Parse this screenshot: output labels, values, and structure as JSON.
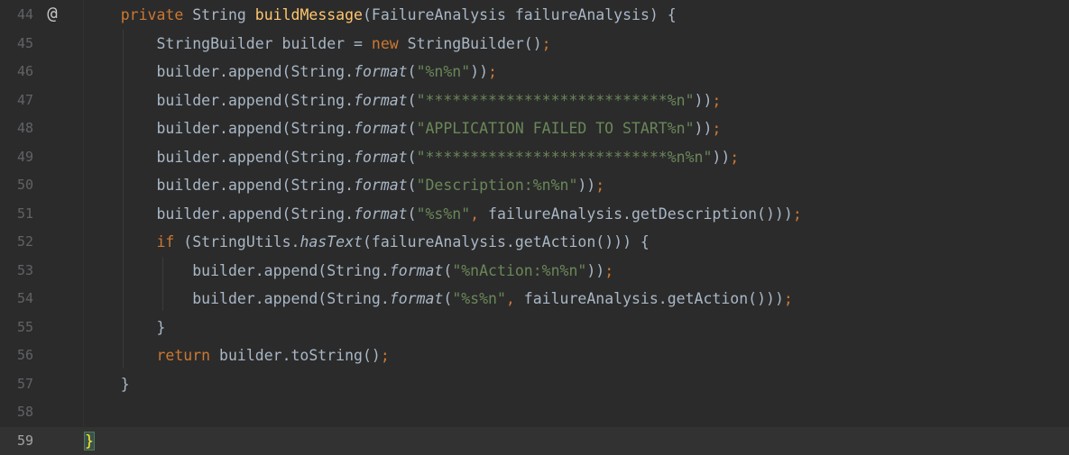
{
  "editor": {
    "language": "java",
    "current_line": 59,
    "gutter_icon": "at-sign-icon",
    "gutter_icon_glyph": "@",
    "lines": [
      {
        "num": "44",
        "segments": [
          {
            "t": "    ",
            "c": ""
          },
          {
            "t": "private ",
            "c": "kw"
          },
          {
            "t": "String ",
            "c": ""
          },
          {
            "t": "buildMessage",
            "c": "fn"
          },
          {
            "t": "(FailureAnalysis failureAnalysis) {",
            "c": ""
          }
        ]
      },
      {
        "num": "45",
        "segments": [
          {
            "t": "        StringBuilder builder = ",
            "c": ""
          },
          {
            "t": "new ",
            "c": "kw"
          },
          {
            "t": "StringBuilder()",
            "c": ""
          },
          {
            "t": ";",
            "c": "punct"
          }
        ]
      },
      {
        "num": "46",
        "segments": [
          {
            "t": "        builder.append(String.",
            "c": ""
          },
          {
            "t": "format",
            "c": "it"
          },
          {
            "t": "(",
            "c": ""
          },
          {
            "t": "\"%n%n\"",
            "c": "str"
          },
          {
            "t": "))",
            "c": ""
          },
          {
            "t": ";",
            "c": "punct"
          }
        ]
      },
      {
        "num": "47",
        "segments": [
          {
            "t": "        builder.append(String.",
            "c": ""
          },
          {
            "t": "format",
            "c": "it"
          },
          {
            "t": "(",
            "c": ""
          },
          {
            "t": "\"***************************%n\"",
            "c": "str"
          },
          {
            "t": "))",
            "c": ""
          },
          {
            "t": ";",
            "c": "punct"
          }
        ]
      },
      {
        "num": "48",
        "segments": [
          {
            "t": "        builder.append(String.",
            "c": ""
          },
          {
            "t": "format",
            "c": "it"
          },
          {
            "t": "(",
            "c": ""
          },
          {
            "t": "\"APPLICATION FAILED TO START%n\"",
            "c": "str"
          },
          {
            "t": "))",
            "c": ""
          },
          {
            "t": ";",
            "c": "punct"
          }
        ]
      },
      {
        "num": "49",
        "segments": [
          {
            "t": "        builder.append(String.",
            "c": ""
          },
          {
            "t": "format",
            "c": "it"
          },
          {
            "t": "(",
            "c": ""
          },
          {
            "t": "\"***************************%n%n\"",
            "c": "str"
          },
          {
            "t": "))",
            "c": ""
          },
          {
            "t": ";",
            "c": "punct"
          }
        ]
      },
      {
        "num": "50",
        "segments": [
          {
            "t": "        builder.append(String.",
            "c": ""
          },
          {
            "t": "format",
            "c": "it"
          },
          {
            "t": "(",
            "c": ""
          },
          {
            "t": "\"Description:%n%n\"",
            "c": "str"
          },
          {
            "t": "))",
            "c": ""
          },
          {
            "t": ";",
            "c": "punct"
          }
        ]
      },
      {
        "num": "51",
        "segments": [
          {
            "t": "        builder.append(String.",
            "c": ""
          },
          {
            "t": "format",
            "c": "it"
          },
          {
            "t": "(",
            "c": ""
          },
          {
            "t": "\"%s%n\"",
            "c": "str"
          },
          {
            "t": ", ",
            "c": "punct"
          },
          {
            "t": "failureAnalysis.getDescription()))",
            "c": ""
          },
          {
            "t": ";",
            "c": "punct"
          }
        ]
      },
      {
        "num": "52",
        "segments": [
          {
            "t": "        ",
            "c": ""
          },
          {
            "t": "if ",
            "c": "kw"
          },
          {
            "t": "(StringUtils.",
            "c": ""
          },
          {
            "t": "hasText",
            "c": "it"
          },
          {
            "t": "(failureAnalysis.getAction())) {",
            "c": ""
          }
        ]
      },
      {
        "num": "53",
        "segments": [
          {
            "t": "            builder.append(String.",
            "c": ""
          },
          {
            "t": "format",
            "c": "it"
          },
          {
            "t": "(",
            "c": ""
          },
          {
            "t": "\"%nAction:%n%n\"",
            "c": "str"
          },
          {
            "t": "))",
            "c": ""
          },
          {
            "t": ";",
            "c": "punct"
          }
        ]
      },
      {
        "num": "54",
        "segments": [
          {
            "t": "            builder.append(String.",
            "c": ""
          },
          {
            "t": "format",
            "c": "it"
          },
          {
            "t": "(",
            "c": ""
          },
          {
            "t": "\"%s%n\"",
            "c": "str"
          },
          {
            "t": ", ",
            "c": "punct"
          },
          {
            "t": "failureAnalysis.getAction()))",
            "c": ""
          },
          {
            "t": ";",
            "c": "punct"
          }
        ]
      },
      {
        "num": "55",
        "segments": [
          {
            "t": "        }",
            "c": ""
          }
        ]
      },
      {
        "num": "56",
        "segments": [
          {
            "t": "        ",
            "c": ""
          },
          {
            "t": "return ",
            "c": "kw"
          },
          {
            "t": "builder.toString()",
            "c": ""
          },
          {
            "t": ";",
            "c": "punct"
          }
        ]
      },
      {
        "num": "57",
        "segments": [
          {
            "t": "    }",
            "c": ""
          }
        ]
      },
      {
        "num": "58",
        "segments": []
      },
      {
        "num": "59",
        "segments": [
          {
            "t": "}",
            "c": "brace-hl"
          }
        ]
      }
    ]
  },
  "colors": {
    "background": "#2b2b2b",
    "keyword": "#cc7832",
    "method_decl": "#ffc66d",
    "string": "#6a8759",
    "default_text": "#a9b7c6",
    "line_number": "#606366"
  }
}
